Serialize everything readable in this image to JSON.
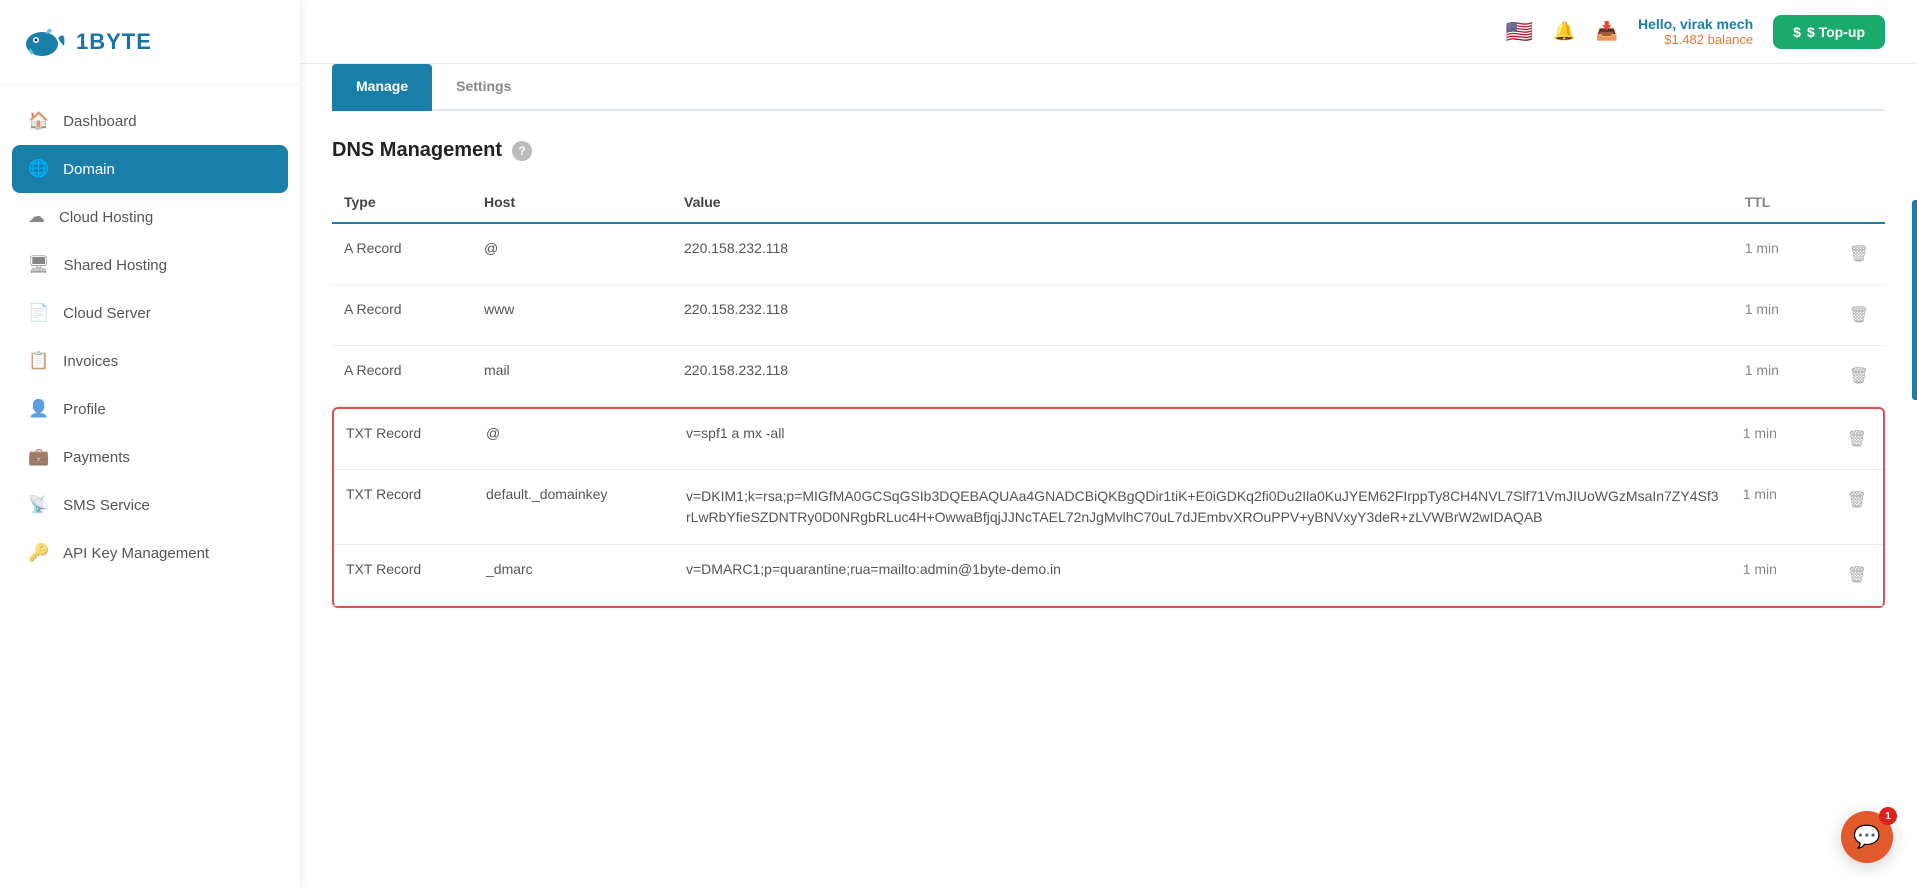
{
  "sidebar": {
    "logo_text": "1BYTE",
    "items": [
      {
        "id": "dashboard",
        "label": "Dashboard",
        "icon": "🏠",
        "active": false
      },
      {
        "id": "domain",
        "label": "Domain",
        "icon": "🌐",
        "active": true
      },
      {
        "id": "cloud-hosting",
        "label": "Cloud Hosting",
        "icon": "☁",
        "active": false
      },
      {
        "id": "shared-hosting",
        "label": "Shared Hosting",
        "icon": "🖥",
        "active": false
      },
      {
        "id": "cloud-server",
        "label": "Cloud Server",
        "icon": "📄",
        "active": false
      },
      {
        "id": "invoices",
        "label": "Invoices",
        "icon": "📋",
        "active": false
      },
      {
        "id": "profile",
        "label": "Profile",
        "icon": "👤",
        "active": false
      },
      {
        "id": "payments",
        "label": "Payments",
        "icon": "💼",
        "active": false
      },
      {
        "id": "sms-service",
        "label": "SMS Service",
        "icon": "📡",
        "active": false
      },
      {
        "id": "api-key",
        "label": "API Key Management",
        "icon": "🔑",
        "active": false
      }
    ]
  },
  "topbar": {
    "user_hello": "Hello, virak mech",
    "balance": "$1.482 balance",
    "topup_label": "$ Top-up"
  },
  "tabs": [
    {
      "id": "manage",
      "label": "Manage",
      "active": true
    },
    {
      "id": "settings",
      "label": "Settings",
      "active": false
    }
  ],
  "dns": {
    "title": "DNS Management",
    "columns": {
      "type": "Type",
      "host": "Host",
      "value": "Value",
      "ttl": "TTL"
    },
    "records": [
      {
        "type": "A Record",
        "host": "@",
        "value": "220.158.232.118",
        "ttl": "1 min",
        "highlight": false
      },
      {
        "type": "A Record",
        "host": "www",
        "value": "220.158.232.118",
        "ttl": "1 min",
        "highlight": false
      },
      {
        "type": "A Record",
        "host": "mail",
        "value": "220.158.232.118",
        "ttl": "1 min",
        "highlight": false
      },
      {
        "type": "TXT Record",
        "host": "@",
        "value": "v=spf1 a mx -all",
        "ttl": "1 min",
        "highlight": true
      },
      {
        "type": "TXT Record",
        "host": "default._domainkey",
        "value": "v=DKIM1;k=rsa;p=MIGfMA0GCSqGSIb3DQEBAQUAa4GNADCBiQKBgQDir1tiK+E0iGDKq2fi0Du2Ila0KuJYEM62FIrppTy8CH4NVL7Slf71VmJIUoWGzMsaIn7ZY4Sf3rLwRbYfieSZDNTRy0D0NRgbRLuc4H+OwwaBfjqjJJNcTAEL72nJgMvlhC70uL7dJEmbvXROuPPV+yBNVxyY3deR+zLVWBrW2wIDAQAB",
        "ttl": "1 min",
        "highlight": true
      },
      {
        "type": "TXT Record",
        "host": "_dmarc",
        "value": "v=DMARC1;p=quarantine;rua=mailto:admin@1byte-demo.in",
        "ttl": "1 min",
        "highlight": true
      }
    ]
  }
}
